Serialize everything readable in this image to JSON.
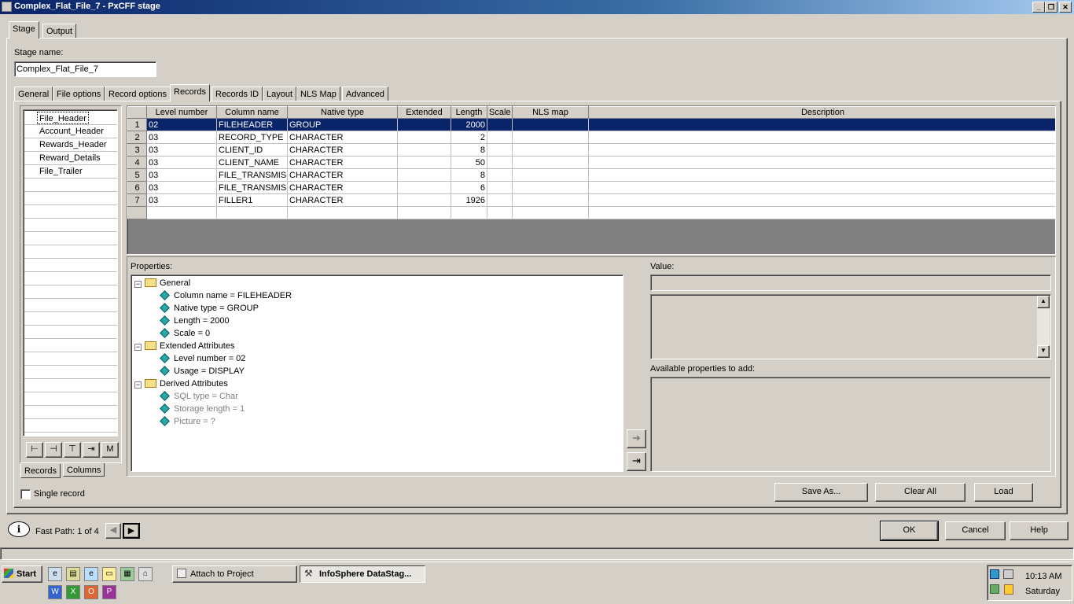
{
  "window": {
    "title": "Complex_Flat_File_7 - PxCFF stage"
  },
  "top_tabs": [
    "Stage",
    "Output"
  ],
  "stage_name": {
    "label": "Stage name:",
    "value": "Complex_Flat_File_7"
  },
  "inner_tabs": [
    "General",
    "File options",
    "Record options",
    "Records",
    "Records ID",
    "Layout",
    "NLS Map",
    "Advanced"
  ],
  "records_list": [
    "File_Header",
    "Account_Header",
    "Rewards_Header",
    "Reward_Details",
    "File_Trailer"
  ],
  "list_tabs": [
    "Records",
    "Columns"
  ],
  "single_record": {
    "label": "Single record",
    "checked": false
  },
  "grid": {
    "headers": [
      "Level number",
      "Column name",
      "Native type",
      "Extended",
      "Length",
      "Scale",
      "NLS map",
      "Description"
    ],
    "rows": [
      {
        "n": "1",
        "level": "02",
        "col": "FILEHEADER",
        "type": "GROUP",
        "ext": "",
        "len": "2000",
        "scale": "",
        "nls": "",
        "desc": ""
      },
      {
        "n": "2",
        "level": "03",
        "col": "RECORD_TYPE",
        "type": "CHARACTER",
        "ext": "",
        "len": "2",
        "scale": "",
        "nls": "",
        "desc": ""
      },
      {
        "n": "3",
        "level": "03",
        "col": "CLIENT_ID",
        "type": "CHARACTER",
        "ext": "",
        "len": "8",
        "scale": "",
        "nls": "",
        "desc": ""
      },
      {
        "n": "4",
        "level": "03",
        "col": "CLIENT_NAME",
        "type": "CHARACTER",
        "ext": "",
        "len": "50",
        "scale": "",
        "nls": "",
        "desc": ""
      },
      {
        "n": "5",
        "level": "03",
        "col": "FILE_TRANSMIS",
        "type": "CHARACTER",
        "ext": "",
        "len": "8",
        "scale": "",
        "nls": "",
        "desc": ""
      },
      {
        "n": "6",
        "level": "03",
        "col": "FILE_TRANSMIS",
        "type": "CHARACTER",
        "ext": "",
        "len": "6",
        "scale": "",
        "nls": "",
        "desc": ""
      },
      {
        "n": "7",
        "level": "03",
        "col": "FILLER1",
        "type": "CHARACTER",
        "ext": "",
        "len": "1926",
        "scale": "",
        "nls": "",
        "desc": ""
      }
    ]
  },
  "properties": {
    "label": "Properties:",
    "groups": [
      {
        "name": "General",
        "items": [
          "Column name = FILEHEADER",
          "Native type = GROUP",
          "Length = 2000",
          "Scale = 0"
        ]
      },
      {
        "name": "Extended Attributes",
        "items": [
          "Level number = 02",
          "Usage = DISPLAY"
        ]
      },
      {
        "name": "Derived Attributes",
        "items": [
          "SQL type = Char",
          "Storage length = 1",
          "Picture = ?"
        ]
      }
    ]
  },
  "value_label": "Value:",
  "available_label": "Available properties to add:",
  "buttons": {
    "save_as": "Save As...",
    "clear_all": "Clear All",
    "load": "Load",
    "ok": "OK",
    "cancel": "Cancel",
    "help": "Help"
  },
  "fast_path": "Fast Path: 1 of 4",
  "taskbar": {
    "start": "Start",
    "tasks": [
      "Attach to Project",
      "InfoSphere DataStag..."
    ],
    "time": "10:13 AM",
    "day": "Saturday"
  }
}
